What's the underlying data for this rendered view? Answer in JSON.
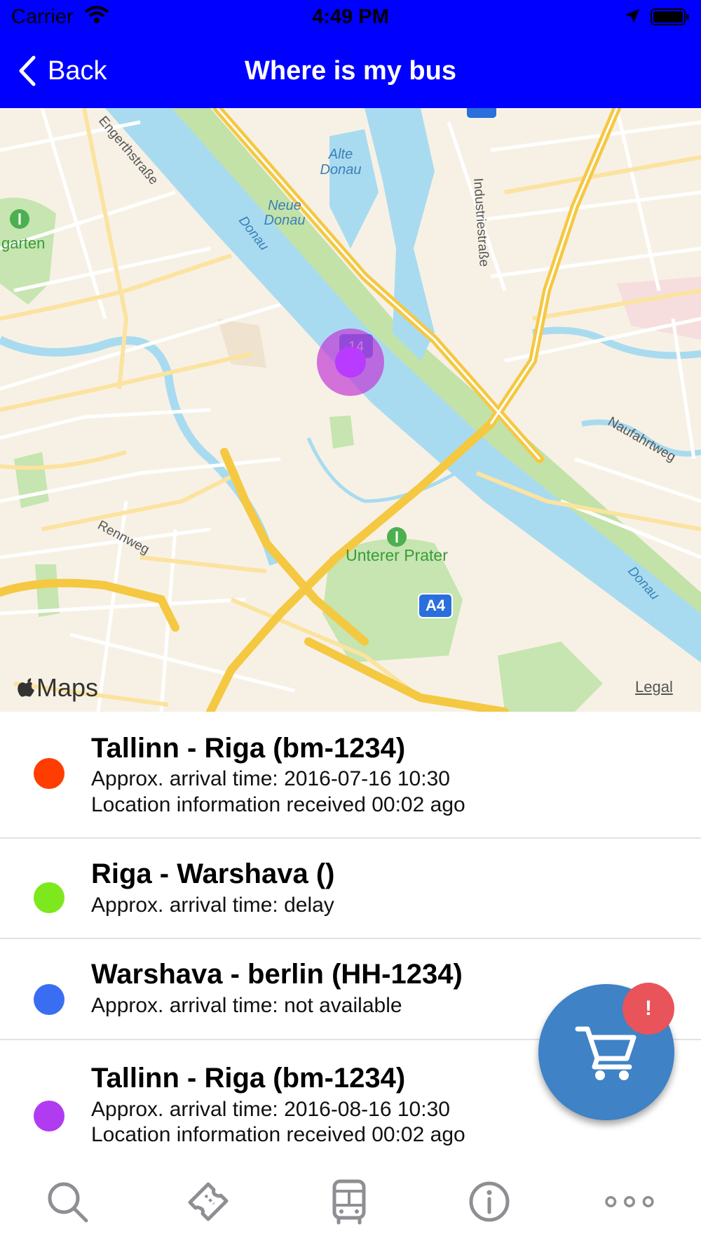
{
  "status_bar": {
    "carrier": "Carrier",
    "time": "4:49 PM",
    "wifi_icon": "wifi-icon",
    "location_icon": "location-arrow-icon",
    "battery_icon": "battery-icon"
  },
  "navbar": {
    "back_label": "Back",
    "title": "Where is my bus",
    "background": "#0000ff"
  },
  "map": {
    "labels": {
      "alte_donau": "Alte Donau",
      "neue_donau": "Neue Donau",
      "donau_1": "Donau",
      "donau_2": "Donau",
      "industriestrasse": "Industriestraße",
      "engerthstrasse": "Engerthstraße",
      "garten": "garten",
      "naufahrtweg": "Naufahrtweg",
      "rennweg": "Rennweg",
      "unterer_prater": "Unterer Prater",
      "a4": "A4",
      "route_14": "14"
    },
    "attribution": "Maps",
    "legal": "Legal",
    "bus_marker_color": "#b93bff"
  },
  "buses": [
    {
      "title": "Tallinn - Riga (bm-1234)",
      "arrival": "Approx. arrival time: 2016-07-16 10:30",
      "location_info": "Location information received 00:02 ago",
      "color": "#ff3d00"
    },
    {
      "title": "Riga - Warshava ()",
      "arrival": "Approx. arrival time: delay",
      "color": "#7ee81e"
    },
    {
      "title": "Warshava - berlin (HH-1234)",
      "arrival": "Approx. arrival time: not available",
      "color": "#3a6ef2"
    },
    {
      "title": "Tallinn - Riga (bm-1234)",
      "arrival": "Approx. arrival time: 2016-08-16 10:30",
      "location_info": "Location information received 00:02 ago",
      "color": "#b13bf0"
    }
  ],
  "cart_fab": {
    "icon": "cart-icon",
    "badge": "!"
  },
  "tabbar": {
    "tabs": [
      "search-icon",
      "ticket-icon",
      "bus-icon",
      "info-icon",
      "more-icon"
    ]
  }
}
